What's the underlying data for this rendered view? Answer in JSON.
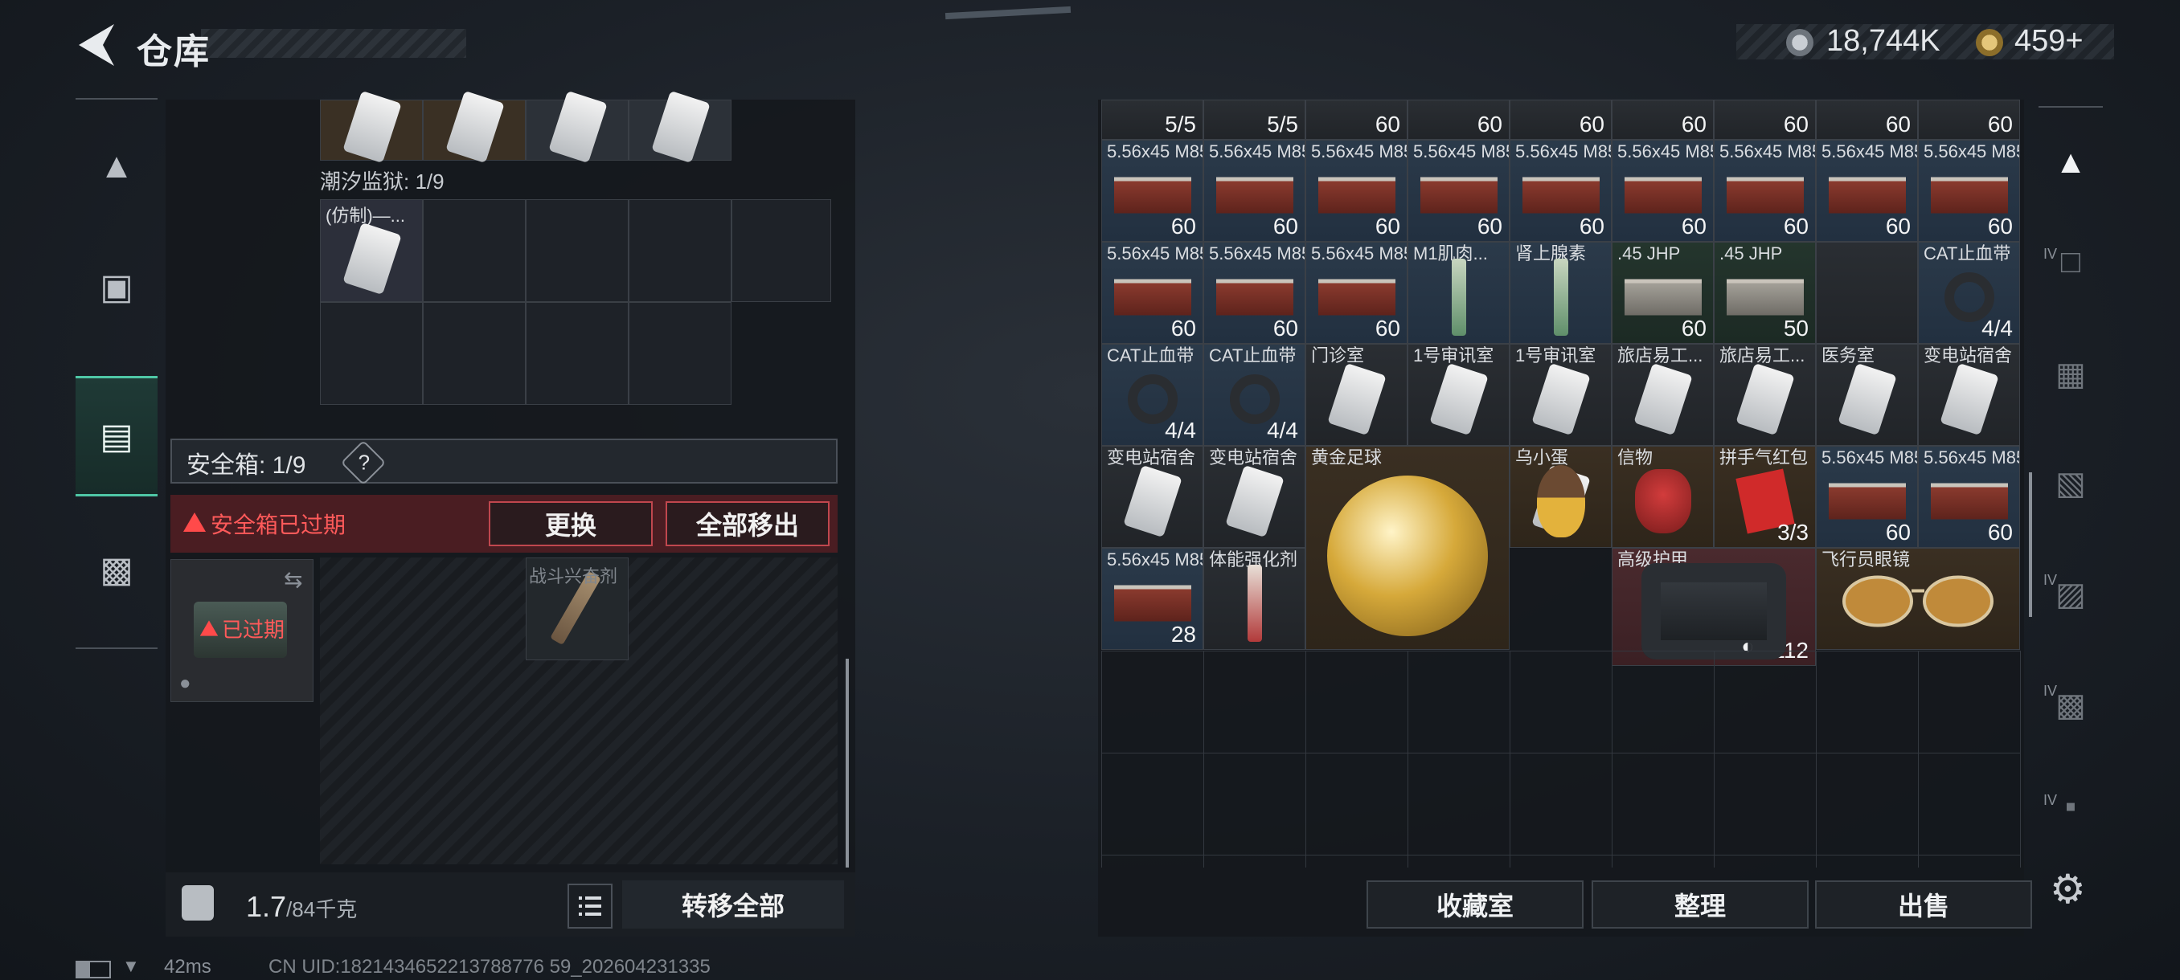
{
  "header": {
    "title": "仓库",
    "back_icon": "back-arrow-icon"
  },
  "currency": {
    "silver_value": "18,744K",
    "gold_value": "459+",
    "silver_icon": "silver-coin-icon",
    "gold_icon": "gold-coin-icon"
  },
  "left_nav": [
    {
      "icon": "gun-icon",
      "active": false
    },
    {
      "icon": "backpack-icon",
      "active": false
    },
    {
      "icon": "container-icon",
      "active": true
    },
    {
      "icon": "briefcase-icon",
      "active": false
    }
  ],
  "left": {
    "prison_label": "潮汐监狱: 1/9",
    "prison_item": "(仿制)—...",
    "safebox_label": "安全箱: 1/9",
    "help": "?",
    "expired_notice": "安全箱已过期",
    "replace_btn": "更换",
    "move_all_btn": "全部移出",
    "box_status": "已过期",
    "combat_item": "战斗兴奋剂",
    "weight_value": "1.7",
    "weight_max": "/84千克",
    "transfer_all_btn": "转移全部"
  },
  "top_counts": [
    "5/5",
    "5/5",
    "60",
    "60",
    "60",
    "60",
    "60",
    "60",
    "60"
  ],
  "items": {
    "r1": [
      {
        "name": "5.56x45 M855",
        "count": "60"
      },
      {
        "name": "5.56x45 M855",
        "count": "60"
      },
      {
        "name": "5.56x45 M855",
        "count": "60"
      },
      {
        "name": "5.56x45 M855",
        "count": "60"
      },
      {
        "name": "5.56x45 M855",
        "count": "60"
      },
      {
        "name": "5.56x45 M855",
        "count": "60"
      },
      {
        "name": "5.56x45 M855",
        "count": "60"
      },
      {
        "name": "5.56x45 M855",
        "count": "60"
      },
      {
        "name": "5.56x45 M855",
        "count": "60"
      }
    ],
    "r2": [
      {
        "name": "5.56x45 M855",
        "count": "60"
      },
      {
        "name": "5.56x45 M855",
        "count": "60"
      },
      {
        "name": "5.56x45 M855",
        "count": "60"
      },
      {
        "name": "M1肌肉...",
        "count": ""
      },
      {
        "name": "肾上腺素",
        "count": ""
      },
      {
        "name": ".45 JHP",
        "count": "60"
      },
      {
        "name": ".45 JHP",
        "count": "50"
      },
      {
        "name": "",
        "count": ""
      },
      {
        "name": "CAT止血带",
        "count": "4/4"
      }
    ],
    "r3": [
      {
        "name": "CAT止血带",
        "count": "4/4"
      },
      {
        "name": "CAT止血带",
        "count": "4/4"
      },
      {
        "name": "门诊室",
        "count": ""
      },
      {
        "name": "1号审讯室",
        "count": ""
      },
      {
        "name": "1号审讯室",
        "count": ""
      },
      {
        "name": "旅店易工...",
        "count": ""
      },
      {
        "name": "旅店易工...",
        "count": ""
      },
      {
        "name": "医务室",
        "count": ""
      },
      {
        "name": "变电站宿舍",
        "count": ""
      }
    ],
    "r4": [
      {
        "name": "变电站宿舍",
        "count": ""
      },
      {
        "name": "变电站宿舍",
        "count": ""
      },
      {
        "name": "黄金足球",
        "count": ""
      },
      {
        "name": "乌小蛋",
        "count": ""
      },
      {
        "name": "信物",
        "count": ""
      },
      {
        "name": "拼手气红包",
        "count": "3/3"
      },
      {
        "name": "5.56x45 M855",
        "count": "60"
      },
      {
        "name": "5.56x45 M855",
        "count": "60"
      }
    ],
    "r5": [
      {
        "name": "5.56x45 M855",
        "count": "28"
      },
      {
        "name": "体能强化剂",
        "count": ""
      },
      {
        "name": "高级护甲",
        "count": "112"
      },
      {
        "name": "飞行员眼镜",
        "count": ""
      }
    ]
  },
  "right_buttons": {
    "collection": "收藏室",
    "organize": "整理",
    "sell": "出售"
  },
  "right_nav": [
    {
      "icon": "home-vault-icon",
      "tag": ""
    },
    {
      "icon": "folder-icon",
      "tag": "IV"
    },
    {
      "icon": "folder-add-icon",
      "tag": ""
    },
    {
      "icon": "folder-stack-icon",
      "tag": ""
    },
    {
      "icon": "folder-key-icon",
      "tag": "IV"
    },
    {
      "icon": "folder-lock-icon",
      "tag": "IV"
    },
    {
      "icon": "folder-gear-icon",
      "tag": "IV"
    }
  ],
  "status": {
    "ping": "42ms",
    "uid": "CN UID:1821434652213788776 59_202604231335"
  }
}
